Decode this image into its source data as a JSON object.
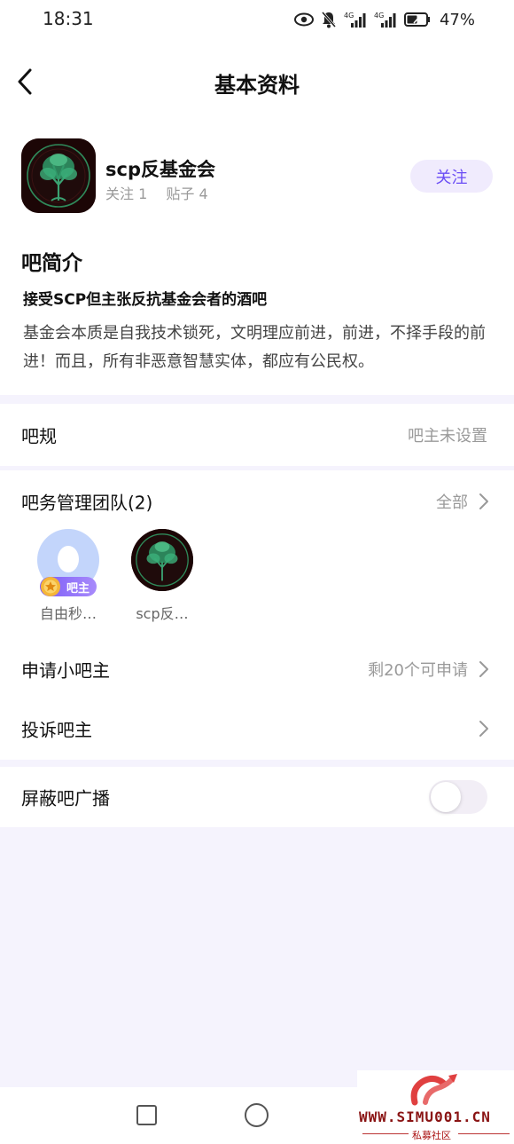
{
  "status_bar": {
    "time": "18:31",
    "battery": "47%",
    "icons": [
      "eye-icon",
      "mute-bell-icon",
      "signal-4g-icon",
      "signal-4g-icon",
      "battery-icon"
    ]
  },
  "nav": {
    "title": "基本资料",
    "back_icon": "back-chevron-icon"
  },
  "bar": {
    "name": "scp反基金会",
    "follow_count": "关注 1",
    "post_count": "贴子 4",
    "follow_label": "关注"
  },
  "intro": {
    "heading": "吧简介",
    "subtitle": "接受SCP但主张反抗基金会者的酒吧",
    "body": "基金会本质是自我技术锁死，文明理应前进，前进，不择手段的前进！而且，所有非恶意智慧实体，都应有公民权。"
  },
  "rules": {
    "label": "吧规",
    "value": "吧主未设置"
  },
  "team": {
    "label": "吧务管理团队(2)",
    "all_label": "全部",
    "members": [
      {
        "name": "自由秒…",
        "badge": "吧主"
      },
      {
        "name": "scp反…"
      }
    ]
  },
  "apply": {
    "label": "申请小吧主",
    "value": "剩20个可申请"
  },
  "report": {
    "label": "投诉吧主"
  },
  "block_ads": {
    "label": "屏蔽吧广播",
    "enabled": false
  },
  "watermark": {
    "text": "WWW.SIMU001.CN",
    "sub": "私募社区"
  },
  "colors": {
    "accent": "#6a4df5",
    "follow_bg": "#f0ebfd",
    "page_bg": "#f5f3fd"
  }
}
